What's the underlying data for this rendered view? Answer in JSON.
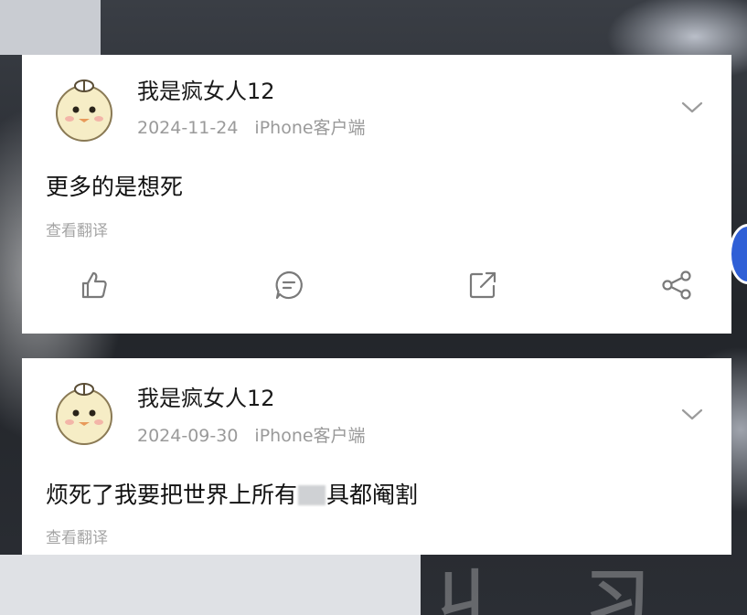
{
  "posts": [
    {
      "username": "我是疯女人12",
      "date": "2024-11-24",
      "client": "iPhone客户端",
      "content_before": "更多的是想死",
      "content_after": "",
      "translate_label": "查看翻译"
    },
    {
      "username": "我是疯女人12",
      "date": "2024-09-30",
      "client": "iPhone客户端",
      "content_before": "烦死了我要把世界上所有",
      "content_after": "具都阉割",
      "translate_label": "查看翻译"
    }
  ],
  "icons": {
    "like": "thumbs-up-icon",
    "comment": "comment-icon",
    "forward": "forward-icon",
    "share": "share-icon",
    "more": "chevron-down-icon",
    "avatar": "chick-avatar"
  },
  "colors": {
    "accent_blue": "#2f5fd6",
    "meta_gray": "#9a9a9a"
  }
}
